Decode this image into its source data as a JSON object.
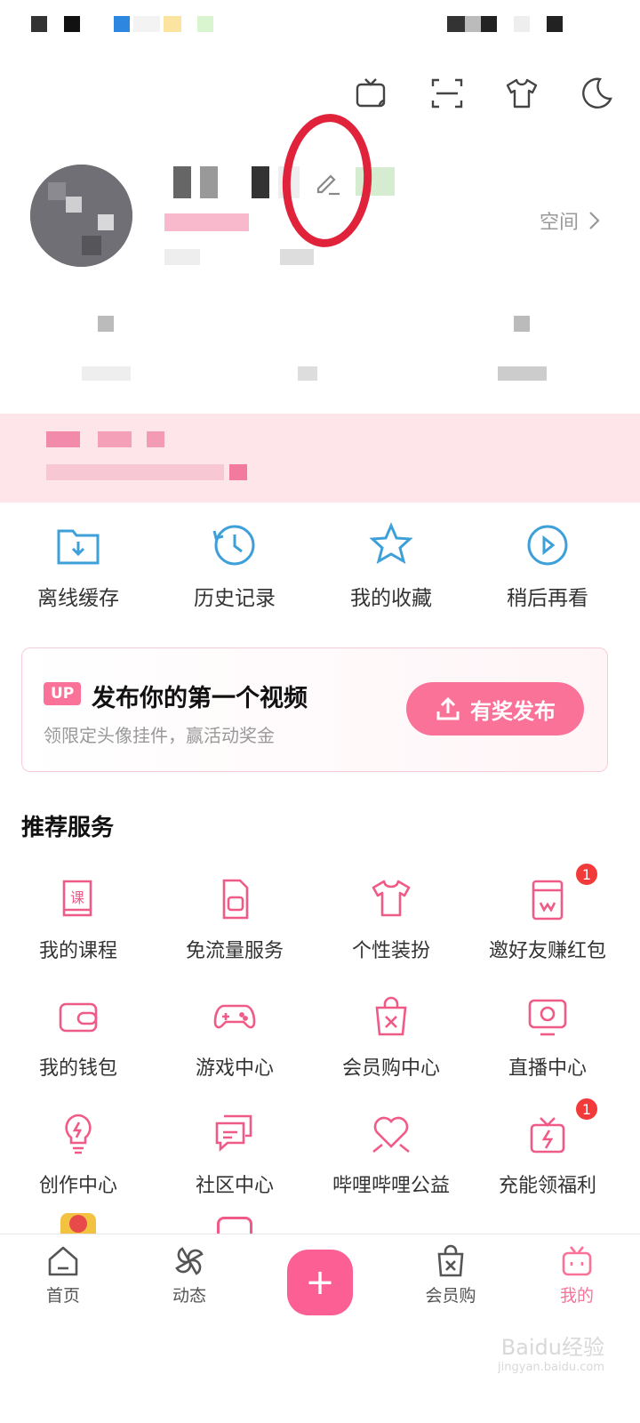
{
  "topbar": {
    "icons": [
      "tv-cast-icon",
      "scan-icon",
      "tshirt-icon",
      "moon-icon"
    ]
  },
  "profile": {
    "space_label": "空间"
  },
  "quick_actions": [
    {
      "label": "离线缓存",
      "icon": "download-folder-icon"
    },
    {
      "label": "历史记录",
      "icon": "history-clock-icon"
    },
    {
      "label": "我的收藏",
      "icon": "star-icon"
    },
    {
      "label": "稍后再看",
      "icon": "watch-later-icon"
    }
  ],
  "upload_card": {
    "badge": "UP",
    "title": "发布你的第一个视频",
    "subtitle": "领限定头像挂件，赢活动奖金",
    "button_label": "有奖发布"
  },
  "services": {
    "title": "推荐服务",
    "items": [
      {
        "label": "我的课程",
        "icon": "course-book-icon"
      },
      {
        "label": "免流量服务",
        "icon": "sim-card-icon"
      },
      {
        "label": "个性装扮",
        "icon": "tshirt-icon"
      },
      {
        "label": "邀好友赚红包",
        "icon": "red-envelope-icon",
        "badge": "1"
      },
      {
        "label": "我的钱包",
        "icon": "wallet-icon"
      },
      {
        "label": "游戏中心",
        "icon": "gamepad-icon"
      },
      {
        "label": "会员购中心",
        "icon": "shopping-bag-icon"
      },
      {
        "label": "直播中心",
        "icon": "live-tv-icon"
      },
      {
        "label": "创作中心",
        "icon": "lightbulb-icon"
      },
      {
        "label": "社区中心",
        "icon": "chat-bubbles-icon"
      },
      {
        "label": "哔哩哔哩公益",
        "icon": "heart-hands-icon"
      },
      {
        "label": "充能领福利",
        "icon": "gift-battery-icon",
        "badge": "1"
      }
    ]
  },
  "bottom_nav": [
    {
      "label": "首页",
      "icon": "home-icon"
    },
    {
      "label": "动态",
      "icon": "pinwheel-icon"
    },
    {
      "label": "",
      "icon": "plus-icon"
    },
    {
      "label": "会员购",
      "icon": "shopping-bag-icon"
    },
    {
      "label": "我的",
      "icon": "bilibili-tv-icon",
      "active": true
    }
  ],
  "watermark": {
    "main": "Baidu经验",
    "sub": "jingyan.baidu.com"
  },
  "colors": {
    "accent": "#fb7299",
    "badge": "#f33a3a",
    "annotation": "#e0223b",
    "quick_icon": "#3ea0d8"
  }
}
